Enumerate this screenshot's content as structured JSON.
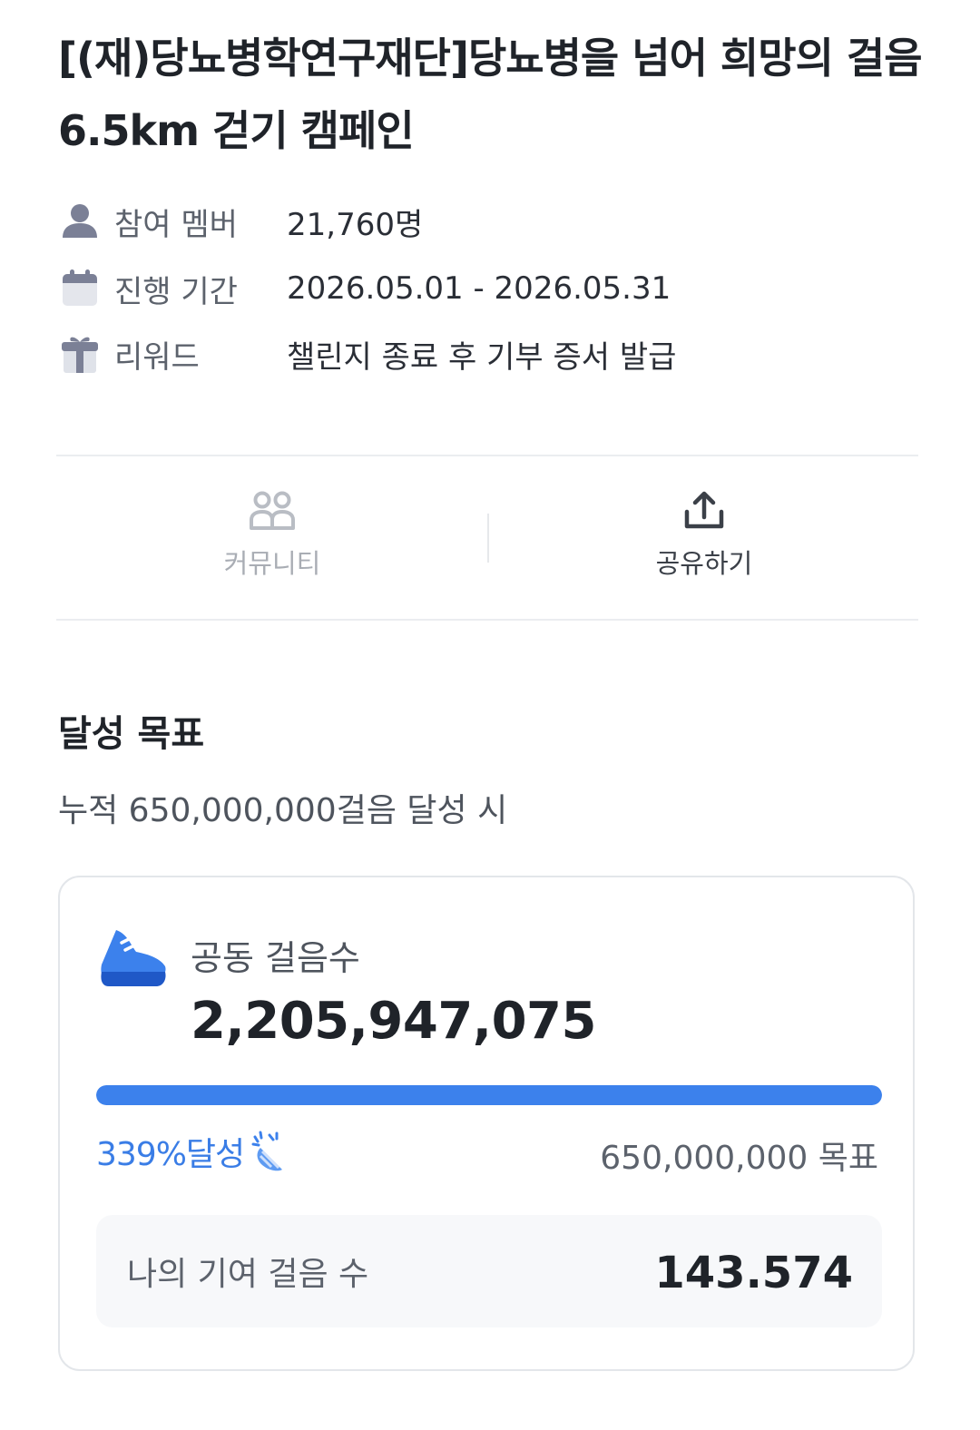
{
  "title": "[(재)당뇨병학연구재단]당뇨병을 넘어 희망의 걸음 6.5km 걷기 캠페인",
  "info": {
    "members_label": "참여 멤버",
    "members_value": "21,760명",
    "period_label": "진행 기간",
    "period_value": "2026.05.01 - 2026.05.31",
    "reward_label": "리워드",
    "reward_value": "챌린지 종료 후 기부 증서 발급",
    "icons": [
      "person-icon",
      "calendar-icon",
      "gift-icon"
    ]
  },
  "actions": {
    "community_label": "커뮤니티",
    "share_label": "공유하기"
  },
  "goal_section": {
    "title": "달성 목표",
    "subtitle": "누적 650,000,000걸음 달성 시"
  },
  "card": {
    "steps_label": "공동 걸음수",
    "steps_value": "2,205,947,075",
    "progress_fraction": 1.0,
    "percent_text": "339%달성",
    "goal_text": "650,000,000 목표",
    "my_label": "나의 기여 걸음 수",
    "my_value": "143.574"
  },
  "colors": {
    "accent": "#3c81ec",
    "icon_gray": "#7b8096",
    "text_dark": "#1f2329"
  }
}
